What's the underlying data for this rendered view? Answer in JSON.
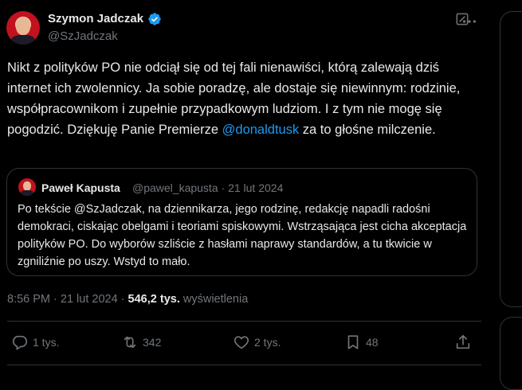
{
  "tweet": {
    "author_name": "Szymon Jadczak",
    "author_handle": "@SzJadczak",
    "text_before_mention": "Nikt z polityków PO nie odciął się od tej fali nienawiści, którą zalewają dziś internet ich zwolennicy. Ja sobie poradzę, ale dostaje się niewinnym: rodzinie, współpracownikom i zupełnie przypadkowym ludziom. I z tym nie mogę się pogodzić. Dziękuję Panie Premierze ",
    "mention": "@donaldtusk",
    "text_after_mention": " za to głośne milczenie.",
    "time": "8:56 PM",
    "date": "21 lut 2024",
    "views_count": "546,2 tys.",
    "views_label": "wyświetlenia",
    "meta_separator": " · ",
    "icons": {
      "verified": "verified-badge-icon",
      "grok": "grok-icon",
      "more": "more-icon"
    }
  },
  "quote": {
    "author_name": "Paweł Kapusta",
    "author_handle": "@pawel_kapusta",
    "date": "21 lut 2024",
    "separator": " · ",
    "text": "Po tekście @SzJadczak, na dziennikarza, jego rodzinę, redakcję napadli radośni demokraci, ciskając obelgami i teoriami spiskowymi. Wstrząsająca jest cicha akceptacja polityków PO. Do wyborów szliście z hasłami naprawy standardów, a tu tkwicie w zgniliźnie po uszy. Wstyd to mało."
  },
  "actions": {
    "reply_count": "1 tys.",
    "retweet_count": "342",
    "like_count": "2 tys.",
    "bookmark_count": "48",
    "icons": [
      "reply-icon",
      "retweet-icon",
      "like-icon",
      "bookmark-icon",
      "share-icon"
    ]
  },
  "colors": {
    "background": "#000000",
    "text": "#e7e9ea",
    "secondary": "#71767b",
    "accent": "#1d9bf0",
    "border": "#2f3336"
  }
}
